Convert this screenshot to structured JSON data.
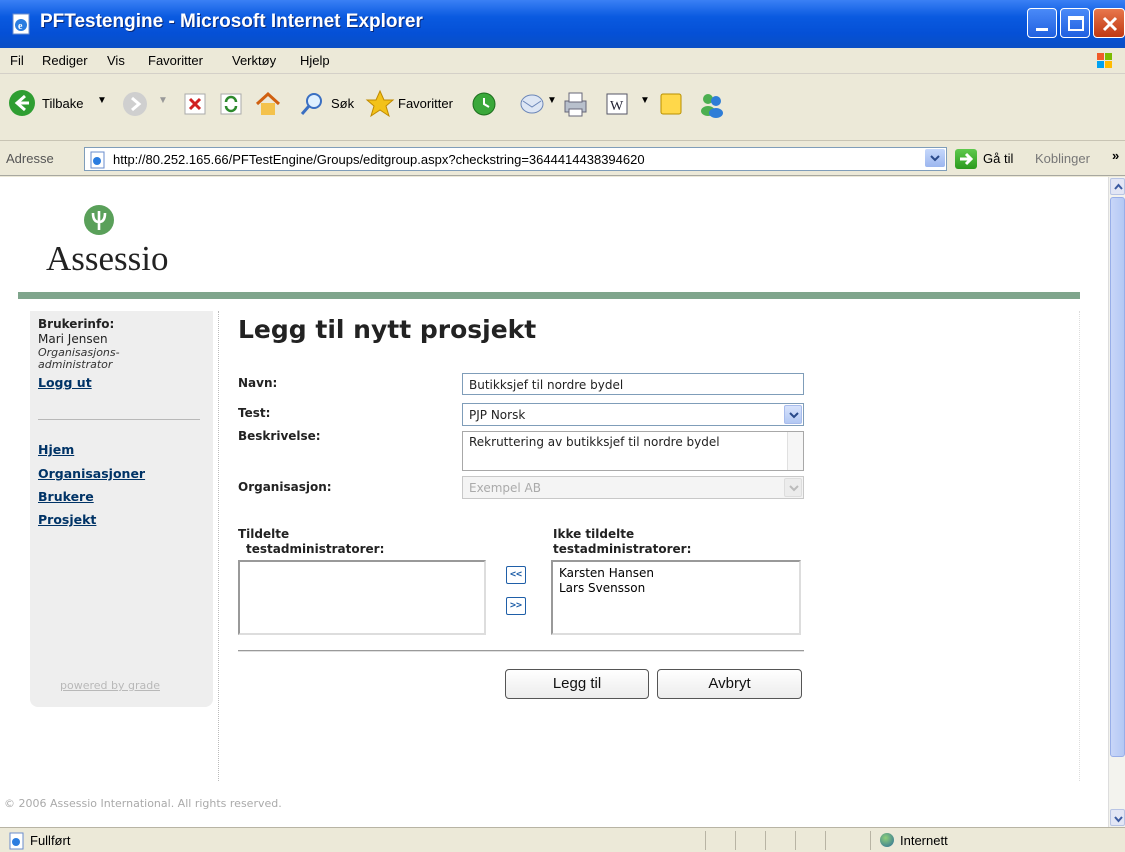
{
  "window": {
    "title": "PFTestengine - Microsoft Internet Explorer"
  },
  "menu": [
    "Fil",
    "Rediger",
    "Vis",
    "Favoritter",
    "Verktøy",
    "Hjelp"
  ],
  "toolbar": {
    "back_label": "Tilbake",
    "search_label": "Søk",
    "favorites_label": "Favoritter"
  },
  "address": {
    "label": "Adresse",
    "url": "http://80.252.165.66/PFTestEngine/Groups/editgroup.aspx?checkstring=3644414438394620",
    "go_label": "Gå til",
    "links_label": "Koblinger"
  },
  "logo": {
    "text": "Assessio"
  },
  "sidebar": {
    "userinfo_label": "Brukerinfo:",
    "user_name": "Mari Jensen",
    "user_role": "Organisasjons-administrator",
    "logout": "Logg ut",
    "nav": [
      "Hjem",
      "Organisasjoner",
      "Brukere",
      "Prosjekt"
    ],
    "powered_by": "powered by grade"
  },
  "form": {
    "title": "Legg til nytt prosjekt",
    "name_label": "Navn:",
    "name_value": "Butikksjef til nordre bydel",
    "test_label": "Test:",
    "test_value": "PJP Norsk",
    "description_label": "Beskrivelse:",
    "description_value": "Rekruttering av butikksjef til nordre bydel",
    "organisation_label": "Organisasjon:",
    "organisation_value": "Exempel AB",
    "assigned_label_line1": "Tildelte",
    "assigned_label_line2": "testadministratorer:",
    "assigned": [],
    "unassigned_label_line1": "Ikke tildelte",
    "unassigned_label_line2": "testadministratorer:",
    "unassigned": [
      "Karsten Hansen",
      "Lars Svensson"
    ],
    "move_left": "<<",
    "move_right": ">>",
    "add_button": "Legg til",
    "cancel_button": "Avbryt"
  },
  "footer": {
    "copyright": "© 2006 Assessio International. All rights reserved."
  },
  "status": {
    "text": "Fullført",
    "zone": "Internett"
  },
  "colors": {
    "titlebar": "#0a5ae0",
    "brand_green": "#7fa58c",
    "nav_link": "#003366"
  }
}
